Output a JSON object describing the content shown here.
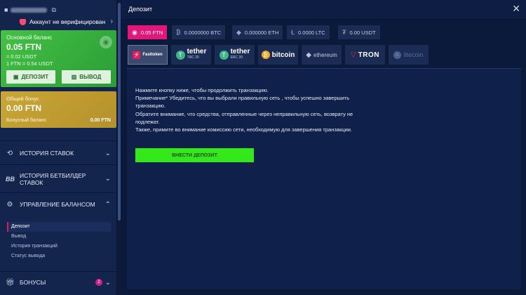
{
  "sidebar": {
    "verify_text": "Аккаунт не верифицирован",
    "main_balance": {
      "label": "Основной баланс",
      "amount": "0.05 FTN",
      "usdt": "≈ 0.02 USDT",
      "rate": "1 FTN = 0.54 USDT",
      "deposit_label": "ДЕПОЗИТ",
      "withdraw_label": "ВЫВОД"
    },
    "bonus_balance": {
      "label": "Общий бонус",
      "amount": "0.00 FTN",
      "row_label": "Бонусный баланс",
      "row_value": "0.00 FTN"
    },
    "menu": {
      "history_bets": "ИСТОРИЯ СТАВОК",
      "history_betbuilder": "ИСТОРИЯ БЕТБИЛДЕР СТАВОК",
      "balance_management": "УПРАВЛЕНИЕ БАЛАНСОМ",
      "bonuses": "БОНУСЫ",
      "bonuses_badge": "2"
    },
    "submenu": [
      "Депозит",
      "Вывод",
      "История транзакций",
      "Статус вывода"
    ]
  },
  "header": {
    "title": "Депозит"
  },
  "currency_tabs": [
    "0.05 FTN",
    "0.0000000 BTC",
    "0.000000 ETH",
    "0.0000 LTC",
    "0.00 USDT"
  ],
  "payment_methods": {
    "fasttoken": "Fasttoken",
    "tether_trc": {
      "name": "tether",
      "net": "TRC 20"
    },
    "tether_erc": {
      "name": "tether",
      "net": "ERC 20"
    },
    "bitcoin": "bitcoin",
    "ethereum": "ethereum",
    "tron": "TRON",
    "litecoin": "litecoin"
  },
  "content": {
    "line1": "Нажмите кнопку ниже, чтобы продолжить транзакцию.",
    "line2": "Примечание* Убедитесь, что вы выбрали правильную сеть , чтобы успешно завершить транзакцию.",
    "line3": "Обратите внимание, что средства, отправленные через неправильную сеть, возврату не подлежат.",
    "line4": "Также, примите во внимание комиссию сети, необходимую для завершения транзакции.",
    "button": "ВНЕСТИ ДЕПОЗИТ"
  },
  "colors": {
    "accent": "#e3177a",
    "green": "#35e81a",
    "gold": "#c9a637",
    "bg": "#0b1a3a"
  }
}
